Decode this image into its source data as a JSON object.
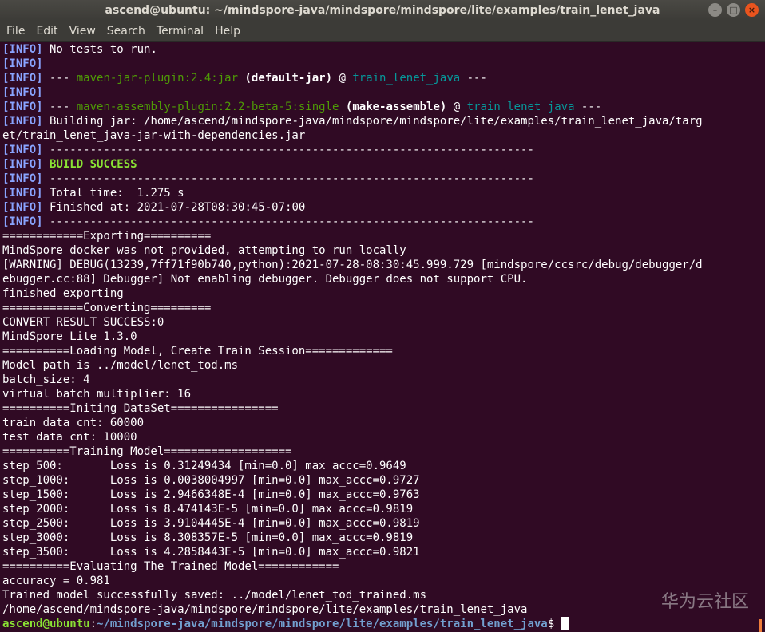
{
  "window": {
    "title": "ascend@ubuntu: ~/mindspore-java/mindspore/mindspore/lite/examples/train_lenet_java",
    "buttons": {
      "minimize": "–",
      "maximize": "□",
      "close": "×"
    }
  },
  "menu": [
    "File",
    "Edit",
    "View",
    "Search",
    "Terminal",
    "Help"
  ],
  "colors": {
    "background": "#300a24",
    "info_tag": "#89a4ff",
    "plugin": "#4e9a06",
    "project": "#06989a",
    "success": "#8ae234",
    "prompt_path": "#729fcf"
  },
  "lines": [
    [
      {
        "t": "[INFO]",
        "c": "info"
      },
      {
        "t": " No tests to run."
      }
    ],
    [
      {
        "t": "[INFO]",
        "c": "info"
      }
    ],
    [
      {
        "t": "[INFO]",
        "c": "info"
      },
      {
        "t": " --- "
      },
      {
        "t": "maven-jar-plugin:2.4:jar",
        "c": "plugin"
      },
      {
        "t": " "
      },
      {
        "t": "(default-jar)",
        "c": "bold"
      },
      {
        "t": " @ "
      },
      {
        "t": "train_lenet_java",
        "c": "proj"
      },
      {
        "t": " ---"
      }
    ],
    [
      {
        "t": "[INFO]",
        "c": "info"
      }
    ],
    [
      {
        "t": "[INFO]",
        "c": "info"
      },
      {
        "t": " --- "
      },
      {
        "t": "maven-assembly-plugin:2.2-beta-5:single",
        "c": "plugin"
      },
      {
        "t": " "
      },
      {
        "t": "(make-assemble)",
        "c": "bold"
      },
      {
        "t": " @ "
      },
      {
        "t": "train_lenet_java",
        "c": "proj"
      },
      {
        "t": " ---"
      }
    ],
    [
      {
        "t": "[INFO]",
        "c": "info"
      },
      {
        "t": " Building jar: /home/ascend/mindspore-java/mindspore/mindspore/lite/examples/train_lenet_java/targ"
      }
    ],
    [
      {
        "t": "et/train_lenet_java-jar-with-dependencies.jar"
      }
    ],
    [
      {
        "t": "[INFO]",
        "c": "info"
      },
      {
        "t": " ------------------------------------------------------------------------"
      }
    ],
    [
      {
        "t": "[INFO]",
        "c": "info"
      },
      {
        "t": " "
      },
      {
        "t": "BUILD SUCCESS",
        "c": "success"
      }
    ],
    [
      {
        "t": "[INFO]",
        "c": "info"
      },
      {
        "t": " ------------------------------------------------------------------------"
      }
    ],
    [
      {
        "t": "[INFO]",
        "c": "info"
      },
      {
        "t": " Total time:  1.275 s"
      }
    ],
    [
      {
        "t": "[INFO]",
        "c": "info"
      },
      {
        "t": " Finished at: 2021-07-28T08:30:45-07:00"
      }
    ],
    [
      {
        "t": "[INFO]",
        "c": "info"
      },
      {
        "t": " ------------------------------------------------------------------------"
      }
    ],
    [
      {
        "t": "============Exporting=========="
      }
    ],
    [
      {
        "t": "MindSpore docker was not provided, attempting to run locally"
      }
    ],
    [
      {
        "t": "[WARNING] DEBUG(13239,7ff71f90b740,python):2021-07-28-08:30:45.999.729 [mindspore/ccsrc/debug/debugger/d"
      }
    ],
    [
      {
        "t": "ebugger.cc:88] Debugger] Not enabling debugger. Debugger does not support CPU."
      }
    ],
    [
      {
        "t": "finished exporting"
      }
    ],
    [
      {
        "t": "============Converting========="
      }
    ],
    [
      {
        "t": "CONVERT RESULT SUCCESS:0"
      }
    ],
    [
      {
        "t": "MindSpore Lite 1.3.0"
      }
    ],
    [
      {
        "t": "==========Loading Model, Create Train Session============="
      }
    ],
    [
      {
        "t": "Model path is ../model/lenet_tod.ms"
      }
    ],
    [
      {
        "t": "batch_size: 4"
      }
    ],
    [
      {
        "t": "virtual batch multiplier: 16"
      }
    ],
    [
      {
        "t": "==========Initing DataSet================"
      }
    ],
    [
      {
        "t": "train data cnt: 60000"
      }
    ],
    [
      {
        "t": "test data cnt: 10000"
      }
    ],
    [
      {
        "t": "==========Training Model==================="
      }
    ],
    [
      {
        "t": "step_500:       Loss is 0.31249434 [min=0.0] max_accc=0.9649"
      }
    ],
    [
      {
        "t": "step_1000:      Loss is 0.0038004997 [min=0.0] max_accc=0.9727"
      }
    ],
    [
      {
        "t": "step_1500:      Loss is 2.9466348E-4 [min=0.0] max_accc=0.9763"
      }
    ],
    [
      {
        "t": "step_2000:      Loss is 8.474143E-5 [min=0.0] max_accc=0.9819"
      }
    ],
    [
      {
        "t": "step_2500:      Loss is 3.9104445E-4 [min=0.0] max_accc=0.9819"
      }
    ],
    [
      {
        "t": "step_3000:      Loss is 8.308357E-5 [min=0.0] max_accc=0.9819"
      }
    ],
    [
      {
        "t": "step_3500:      Loss is 4.2858443E-5 [min=0.0] max_accc=0.9821"
      }
    ],
    [
      {
        "t": "==========Evaluating The Trained Model============"
      }
    ],
    [
      {
        "t": "accuracy = 0.981"
      }
    ],
    [
      {
        "t": "Trained model successfully saved: ../model/lenet_tod_trained.ms"
      }
    ],
    [
      {
        "t": "/home/ascend/mindspore-java/mindspore/mindspore/lite/examples/train_lenet_java"
      }
    ]
  ],
  "prompt": {
    "user": "ascend@ubuntu",
    "sep": ":",
    "path": "~/mindspore-java/mindspore/mindspore/lite/examples/train_lenet_java",
    "symbol": "$"
  },
  "watermark": "华为云社区"
}
